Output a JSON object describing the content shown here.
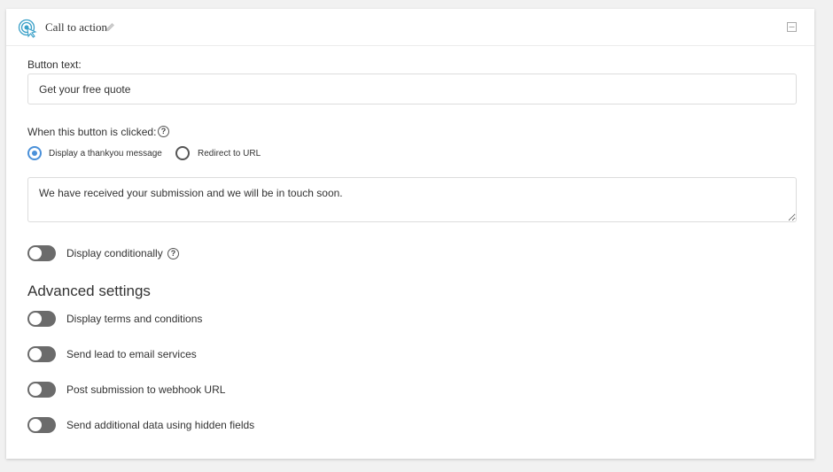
{
  "panel": {
    "title": "Call to action",
    "icons": {
      "header": "target-click-icon",
      "edit": "pencil-icon",
      "collapse": "collapse-icon"
    }
  },
  "button_text": {
    "label": "Button text:",
    "value": "Get your free quote"
  },
  "on_click": {
    "label": "When this button is clicked:",
    "help": "?",
    "options": [
      {
        "label": "Display a thankyou message",
        "selected": true
      },
      {
        "label": "Redirect to URL",
        "selected": false
      }
    ],
    "message": "We have received your submission and we will be in touch soon."
  },
  "display_conditionally": {
    "label": "Display conditionally",
    "help": "?",
    "enabled": false
  },
  "advanced": {
    "title": "Advanced settings",
    "toggles": [
      {
        "label": "Display terms and conditions",
        "enabled": false
      },
      {
        "label": "Send lead to email services",
        "enabled": false
      },
      {
        "label": "Post submission to webhook URL",
        "enabled": false
      },
      {
        "label": "Send additional data using hidden fields",
        "enabled": false
      }
    ]
  },
  "colors": {
    "accent": "#4a90d9",
    "toggle_off": "#6b6b6b",
    "icon_teal": "#3aa0c8"
  }
}
